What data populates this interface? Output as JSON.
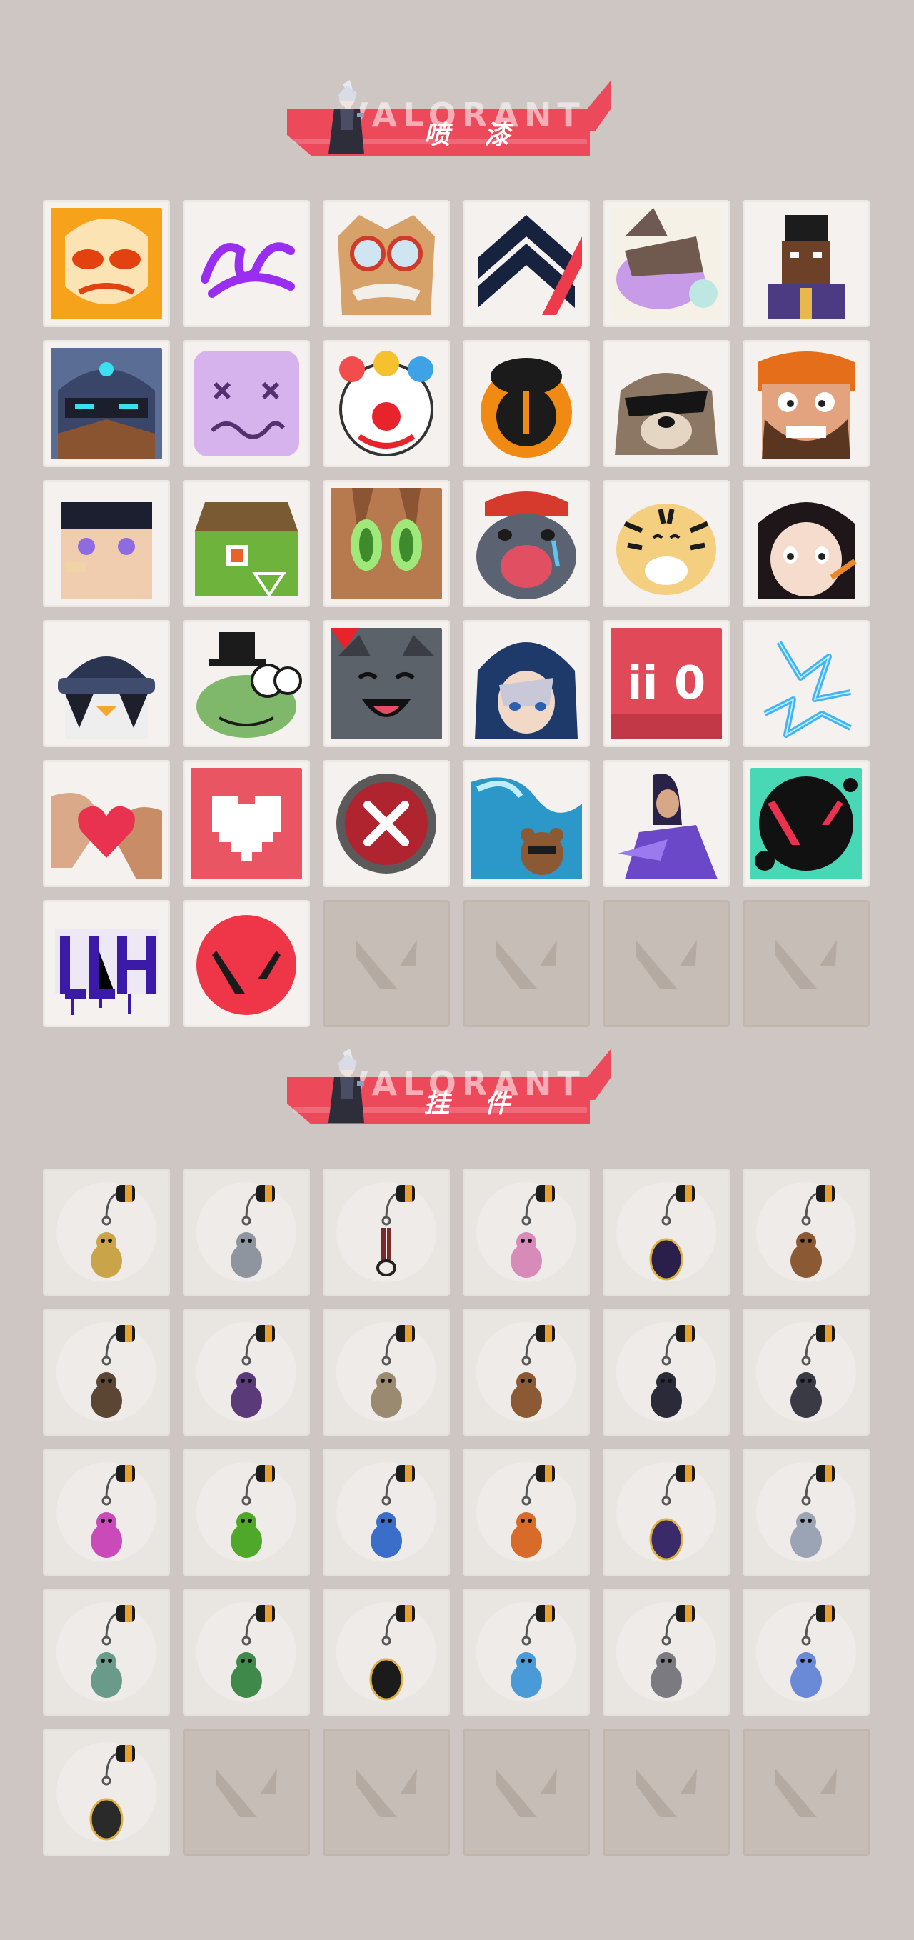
{
  "sections": {
    "sprays": {
      "title": "喷 漆",
      "background_word": "VALORANT"
    },
    "buddies": {
      "title": "挂 件",
      "background_word": "VALORANT"
    }
  },
  "colors": {
    "page_bg": "#cdc6c3",
    "accent": "#ec4a5b",
    "tile_bg": "#f4f1ee",
    "empty_tile_bg": "#c6bdb6"
  },
  "sprays": [
    {
      "icon": "orange-mask-spray"
    },
    {
      "icon": "purple-scribble-spray"
    },
    {
      "icon": "goggles-face-spray"
    },
    {
      "icon": "navy-red-chevron-spray"
    },
    {
      "icon": "sleepy-creature-spray"
    },
    {
      "icon": "pixel-agent-spray"
    },
    {
      "icon": "armored-helmet-spray"
    },
    {
      "icon": "purple-dazed-face-spray"
    },
    {
      "icon": "clown-face-spray"
    },
    {
      "icon": "orange-black-orb-spray"
    },
    {
      "icon": "sunglasses-raccoon-spray"
    },
    {
      "icon": "bearded-grin-spray"
    },
    {
      "icon": "bandaged-face-spray"
    },
    {
      "icon": "green-crate-spray"
    },
    {
      "icon": "green-eyes-closeup-spray"
    },
    {
      "icon": "crying-seal-spray"
    },
    {
      "icon": "tiger-spray"
    },
    {
      "icon": "pencil-girl-spray"
    },
    {
      "icon": "beanie-penguin-spray"
    },
    {
      "icon": "top-hat-frog-spray"
    },
    {
      "icon": "grinning-cat-spray"
    },
    {
      "icon": "hooded-agent-spray"
    },
    {
      "icon": "red-number-spray",
      "text": "ii 0"
    },
    {
      "icon": "neon-blue-scribble-spray"
    },
    {
      "icon": "heart-hands-spray"
    },
    {
      "icon": "pixel-heart-spray"
    },
    {
      "icon": "red-x-button-spray"
    },
    {
      "icon": "wave-bear-spray"
    },
    {
      "icon": "sorceress-agent-spray"
    },
    {
      "icon": "splatter-logo-spray"
    },
    {
      "icon": "purple-graffiti-spray",
      "text": "JLH"
    },
    {
      "icon": "red-circle-logo-spray"
    },
    {
      "icon": "empty-slot"
    },
    {
      "icon": "empty-slot"
    },
    {
      "icon": "empty-slot"
    },
    {
      "icon": "empty-slot"
    }
  ],
  "buddies": [
    {
      "icon": "golden-cat-buddy"
    },
    {
      "icon": "shopping-cart-buddy"
    },
    {
      "icon": "braided-rope-buddy"
    },
    {
      "icon": "cupcake-buddy"
    },
    {
      "icon": "ep9-medallion-buddy"
    },
    {
      "icon": "brown-bear-buddy"
    },
    {
      "icon": "cannon-buddy"
    },
    {
      "icon": "agent-figure-buddy"
    },
    {
      "icon": "hat-agent-buddy"
    },
    {
      "icon": "wooden-box-buddy"
    },
    {
      "icon": "shadow-figure-buddy"
    },
    {
      "icon": "black-cat-buddy"
    },
    {
      "icon": "lava-lamp-buddy"
    },
    {
      "icon": "green-pager-buddy"
    },
    {
      "icon": "blue-robot-buddy"
    },
    {
      "icon": "radio-device-buddy"
    },
    {
      "icon": "ep9-medallion-purple-buddy"
    },
    {
      "icon": "silver-agent-buddy"
    },
    {
      "icon": "mailbox-robot-buddy"
    },
    {
      "icon": "green-can-buddy"
    },
    {
      "icon": "ep9-medallion-yellow-buddy"
    },
    {
      "icon": "ufo-buddy"
    },
    {
      "icon": "grey-pouch-buddy"
    },
    {
      "icon": "snowflake-buddy"
    },
    {
      "icon": "valorant-disc-buddy"
    },
    {
      "icon": "empty-slot"
    },
    {
      "icon": "empty-slot"
    },
    {
      "icon": "empty-slot"
    },
    {
      "icon": "empty-slot"
    },
    {
      "icon": "empty-slot"
    }
  ]
}
